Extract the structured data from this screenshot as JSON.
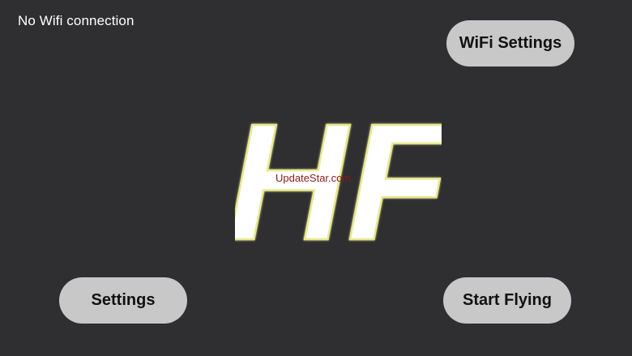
{
  "status": {
    "wifi_text": "No Wifi connection"
  },
  "buttons": {
    "wifi_settings_label": "WiFi Settings",
    "settings_label": "Settings",
    "start_flying_label": "Start Flying"
  },
  "logo": {
    "text": "HF",
    "fill_color": "#ffffff",
    "glow_color": "#e8e890"
  },
  "watermark": {
    "text": "UpdateStar.com"
  },
  "colors": {
    "background": "#2f2f31",
    "button_bg": "#c8c8c8",
    "button_text": "#111111"
  }
}
